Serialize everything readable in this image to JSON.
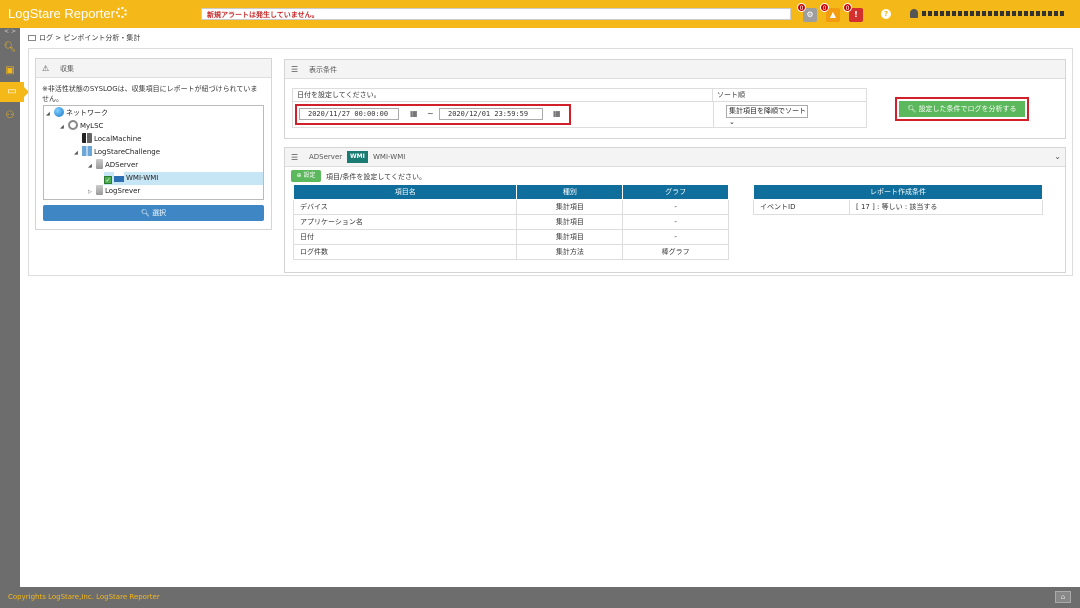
{
  "app": {
    "title": "LogStare Reporter"
  },
  "header": {
    "alert_text": "新規アラートは発生していません。",
    "badges": {
      "settings": "0",
      "warning": "0",
      "error": "0"
    },
    "help": "?"
  },
  "colors": {
    "brand": "#f5b819",
    "primary": "#3f86c5",
    "success": "#5cb85c",
    "table_header": "#0f6e9b",
    "highlight": "#d1202a"
  },
  "nav": {
    "toggle": "< >"
  },
  "breadcrumb": "ログ > ピンポイント分析・集計",
  "collection_panel": {
    "title": "収集",
    "note": "※非活性状態のSYSLOGは、収集項目にレポートが紐づけられていません。",
    "tree": [
      {
        "label": "ネットワーク"
      },
      {
        "label": "MyLSC"
      },
      {
        "label": "LocalMachine"
      },
      {
        "label": "LogStareChallenge"
      },
      {
        "label": "ADServer"
      },
      {
        "label": "WMI-WMI"
      },
      {
        "label": "LogSrever"
      }
    ],
    "select_button": "選択"
  },
  "display_panel": {
    "title": "表示条件",
    "date_label": "日付を設定してください。",
    "start_date": "2020/11/27 00:00:00",
    "end_date": "2020/12/01 23:59:59",
    "tilde": "~",
    "sort_label": "ソート順",
    "sort_value": "集計項目を降順でソート",
    "analyze_button": "設定した条件でログを分析する"
  },
  "ad_panel": {
    "server": "ADServer",
    "badge": "WMI",
    "source": "WMI-WMI",
    "set_button": "設定",
    "set_note": "項目/条件を設定してください。",
    "items_table": {
      "headers": [
        "項目名",
        "種別",
        "グラフ"
      ],
      "rows": [
        [
          "デバイス",
          "集計項目",
          "-"
        ],
        [
          "アプリケーション名",
          "集計項目",
          "-"
        ],
        [
          "日付",
          "集計項目",
          "-"
        ],
        [
          "ログ件数",
          "集計方法",
          "棒グラフ"
        ]
      ]
    },
    "report_table": {
      "header": "レポート作成条件",
      "rows": [
        [
          "イベントID",
          "[ 17 ] : 等しい : 該当する"
        ]
      ]
    }
  },
  "footer": {
    "copyright": "Copyrights LogStare,Inc. LogStare Reporter"
  }
}
